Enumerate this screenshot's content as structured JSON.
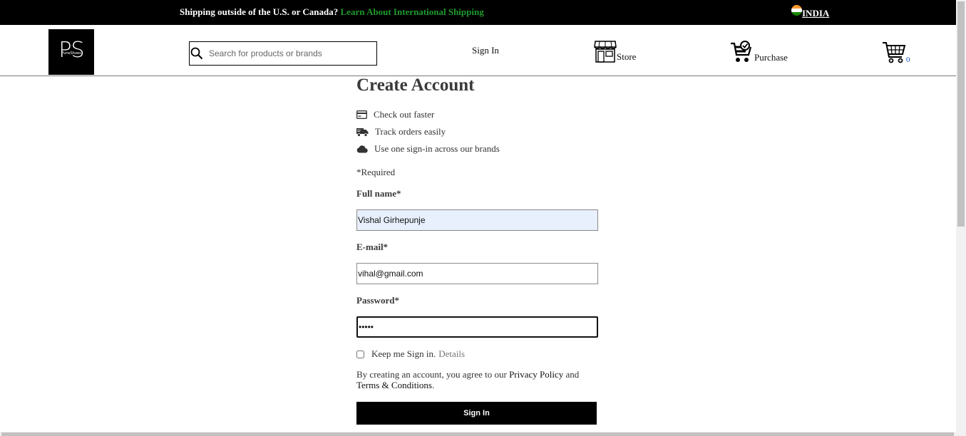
{
  "topbar": {
    "ship_text": "Shipping outside of the U.S. or Canada?",
    "ship_link": "Learn About International Shipping",
    "country": "INDIA"
  },
  "header": {
    "logo_mono": "PS",
    "logo_sub": "PuneShoes",
    "search_placeholder": "Search for products or brands",
    "signin": "Sign In",
    "store": "Store",
    "purchase": "Purchase",
    "cart_count": "0"
  },
  "form": {
    "title": "Create Account",
    "benefits": [
      "Check out faster",
      "Track orders easily",
      "Use one sign-in across our brands"
    ],
    "required_note": "*Required",
    "fullname_label": "Full name*",
    "fullname_value": "Vishal Girhepunje",
    "email_label": "E-mail*",
    "email_value": "vihal@gmail.com",
    "password_label": "Password*",
    "password_value": "12345",
    "keep_signed": "Keep me Sign in.",
    "details": "Details",
    "terms_prefix": "By creating an account, you agree to our",
    "privacy": "Privacy Policy",
    "and": "and",
    "terms": "Terms & Conditions",
    "period": ".",
    "submit": "Sign In"
  },
  "colors": {
    "topbar_bg": "#000000",
    "link_green": "#1e9a2c",
    "autofill_bg": "#e8f0fe",
    "cart_count": "#1a56b8"
  }
}
